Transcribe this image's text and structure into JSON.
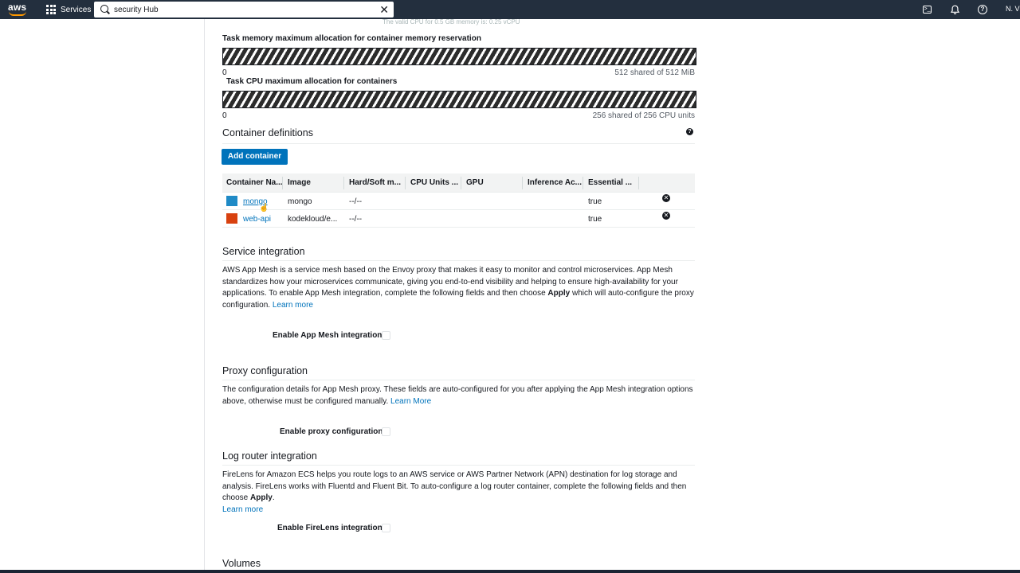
{
  "nav": {
    "logo": "aws",
    "services": "Services",
    "search_value": "security Hub",
    "account": "N. Vi"
  },
  "faded_hint": "The valid CPU for 0.5 GB memory is: 0.25 vCPU",
  "memory": {
    "label": "Task memory maximum allocation for container memory reservation",
    "min": "0",
    "summary": "512 shared of 512 MiB"
  },
  "cpu": {
    "label": "Task CPU maximum allocation for containers",
    "min": "0",
    "summary": "256 shared of 256 CPU units"
  },
  "containers": {
    "title": "Container definitions",
    "add_button": "Add container",
    "columns": [
      "Container Na...",
      "Image",
      "Hard/Soft m...",
      "CPU Units ...",
      "GPU",
      "Inference Ac...",
      "Essential ..."
    ],
    "rows": [
      {
        "name": "mongo",
        "image": "mongo",
        "memory": "--/--",
        "essential": "true",
        "color": "#1f8ac6"
      },
      {
        "name": "web-api",
        "image": "kodekloud/e...",
        "memory": "--/--",
        "essential": "true",
        "color": "#d8410f"
      }
    ]
  },
  "service_integration": {
    "title": "Service integration",
    "text_pre": "AWS App Mesh is a service mesh based on the Envoy proxy that makes it easy to monitor and control microservices. App Mesh standardizes how your microservices communicate, giving you end-to-end visibility and helping to ensure high-availability for your applications. To enable App Mesh integration, complete the following fields and then choose ",
    "text_bold": "Apply",
    "text_post": " which will auto-configure the proxy configuration. ",
    "link": "Learn more",
    "checkbox_label": "Enable App Mesh integration"
  },
  "proxy": {
    "title": "Proxy configuration",
    "text": "The configuration details for App Mesh proxy. These fields are auto-configured for you after applying the App Mesh integration options above, otherwise must be configured manually. ",
    "link": "Learn More",
    "checkbox_label": "Enable proxy configuration"
  },
  "log_router": {
    "title": "Log router integration",
    "text_pre": "FireLens for Amazon ECS helps you route logs to an AWS service or AWS Partner Network (APN) destination for log storage and analysis. FireLens works with Fluentd and Fluent Bit. To auto-configure a log router container, complete the following fields and then choose ",
    "text_bold": "Apply",
    "text_post": ".",
    "link": "Learn more",
    "checkbox_label": "Enable FireLens integration"
  },
  "volumes": {
    "title": "Volumes"
  }
}
